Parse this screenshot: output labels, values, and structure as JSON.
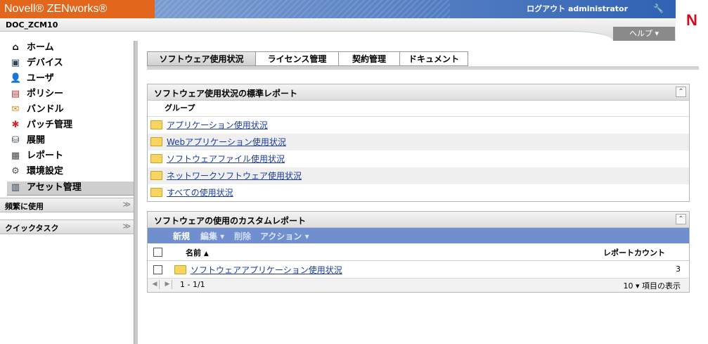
{
  "header": {
    "brand": "Novell® ZENworks®",
    "logout_label": "ログアウト administrator",
    "zone_name": "DOC_ZCM10",
    "help_label": "ヘルプ ▾",
    "logo_letter": "N"
  },
  "sidebar": {
    "items": [
      {
        "label": "ホーム",
        "icon": "home-icon"
      },
      {
        "label": "デバイス",
        "icon": "computer-icon"
      },
      {
        "label": "ユーザ",
        "icon": "user-icon"
      },
      {
        "label": "ポリシー",
        "icon": "policy-icon"
      },
      {
        "label": "バンドル",
        "icon": "bundle-icon"
      },
      {
        "label": "パッチ管理",
        "icon": "patch-icon"
      },
      {
        "label": "展開",
        "icon": "deploy-icon"
      },
      {
        "label": "レポート",
        "icon": "report-icon"
      },
      {
        "label": "環境設定",
        "icon": "settings-icon"
      },
      {
        "label": "アセット管理",
        "icon": "asset-icon",
        "selected": true
      }
    ],
    "frequent_label": "頻繁に使用",
    "quicktask_label": "クイックタスク"
  },
  "tabs": [
    {
      "label": "ソフトウェア使用状況",
      "active": true
    },
    {
      "label": "ライセンス管理",
      "active": false
    },
    {
      "label": "契約管理",
      "active": false
    },
    {
      "label": "ドキュメント",
      "active": false
    }
  ],
  "standard_panel": {
    "title": "ソフトウェア使用状況の標準レポート",
    "group_header": "グループ",
    "groups": [
      "アプリケーション使用状況",
      "Webアプリケーション使用状況",
      "ソフトウェアファイル使用状況",
      "ネットワークソフトウェア使用状況",
      "すべての使用状況"
    ]
  },
  "custom_panel": {
    "title": "ソフトウェアの使用のカスタムレポート",
    "toolbar": {
      "new": "新規",
      "edit": "編集 ▾",
      "delete": "削除",
      "action": "アクション ▾"
    },
    "col_name": "名前",
    "col_count": "レポートカウント",
    "rows": [
      {
        "name": "ソフトウェアアプリケーション使用状況",
        "count": "3"
      }
    ],
    "pager_range": "1 - 1/1",
    "page_size": "10 ▾ 項目の表示"
  }
}
